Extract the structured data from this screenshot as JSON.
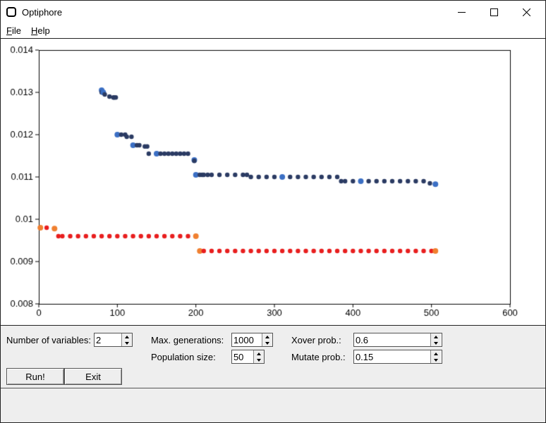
{
  "window": {
    "title": "Optiphore"
  },
  "menu": {
    "file_key": "F",
    "file_rest": "ile",
    "help_key": "H",
    "help_rest": "elp"
  },
  "inputs": {
    "num_vars_label": "Number of variables:",
    "num_vars": "2",
    "max_gen_label": "Max. generations:",
    "max_gen": "1000",
    "pop_size_label": "Population size:",
    "pop_size": "50",
    "xover_label": "Xover prob.:",
    "xover": "0.6",
    "mutate_label": "Mutate prob.:",
    "mutate": "0.15"
  },
  "buttons": {
    "run": "Run!",
    "exit": "Exit"
  },
  "chart_data": {
    "type": "scatter",
    "xlabel": "",
    "ylabel": "",
    "xlim": [
      0,
      600
    ],
    "ylim": [
      0.008,
      0.014
    ],
    "xticks": [
      0,
      100,
      200,
      300,
      400,
      500,
      600
    ],
    "yticks": [
      0.008,
      0.009,
      0.01,
      0.011,
      0.012,
      0.013,
      0.014
    ],
    "color_top": "#2b3b63",
    "color_top_marker": "#3b6fc4",
    "color_bot": "#e81e1e",
    "color_bot_marker": "#f08030",
    "series": [
      {
        "name": "top",
        "x": [
          80,
          80,
          82,
          84,
          90,
          95,
          96,
          98,
          100,
          105,
          110,
          112,
          118,
          120,
          125,
          128,
          135,
          138,
          140,
          150,
          155,
          160,
          165,
          170,
          175,
          180,
          185,
          190,
          198,
          198,
          200,
          205,
          208,
          210,
          215,
          220,
          230,
          240,
          250,
          260,
          265,
          270,
          280,
          290,
          300,
          310,
          320,
          330,
          340,
          350,
          360,
          370,
          380,
          385,
          390,
          400,
          410,
          420,
          430,
          440,
          450,
          460,
          470,
          480,
          490,
          498,
          505
        ],
        "y": [
          0.01305,
          0.013,
          0.013,
          0.01295,
          0.0129,
          0.01288,
          0.01288,
          0.01288,
          0.012,
          0.012,
          0.012,
          0.01195,
          0.01195,
          0.01175,
          0.01175,
          0.01175,
          0.01172,
          0.01172,
          0.01155,
          0.01155,
          0.01155,
          0.01155,
          0.01155,
          0.01155,
          0.01155,
          0.01155,
          0.01155,
          0.01155,
          0.0114,
          0.01138,
          0.01105,
          0.01105,
          0.01105,
          0.01105,
          0.01105,
          0.01105,
          0.01105,
          0.01105,
          0.01105,
          0.01105,
          0.01105,
          0.011,
          0.011,
          0.011,
          0.011,
          0.011,
          0.011,
          0.011,
          0.011,
          0.011,
          0.011,
          0.011,
          0.011,
          0.0109,
          0.0109,
          0.0109,
          0.0109,
          0.0109,
          0.0109,
          0.0109,
          0.0109,
          0.0109,
          0.0109,
          0.0109,
          0.0109,
          0.01085,
          0.01083
        ]
      },
      {
        "name": "bot",
        "x": [
          2,
          10,
          20,
          25,
          30,
          40,
          50,
          60,
          70,
          80,
          90,
          100,
          110,
          120,
          130,
          140,
          150,
          160,
          170,
          180,
          190,
          200,
          205,
          210,
          220,
          230,
          240,
          250,
          260,
          270,
          280,
          290,
          300,
          310,
          320,
          330,
          340,
          350,
          360,
          370,
          380,
          390,
          400,
          410,
          420,
          430,
          440,
          450,
          460,
          470,
          480,
          490,
          500,
          505
        ],
        "y": [
          0.0098,
          0.0098,
          0.00978,
          0.0096,
          0.0096,
          0.0096,
          0.0096,
          0.0096,
          0.0096,
          0.0096,
          0.0096,
          0.0096,
          0.0096,
          0.0096,
          0.0096,
          0.0096,
          0.0096,
          0.0096,
          0.0096,
          0.0096,
          0.0096,
          0.0096,
          0.00925,
          0.00925,
          0.00925,
          0.00925,
          0.00925,
          0.00925,
          0.00925,
          0.00925,
          0.00925,
          0.00925,
          0.00925,
          0.00925,
          0.00925,
          0.00925,
          0.00925,
          0.00925,
          0.00925,
          0.00925,
          0.00925,
          0.00925,
          0.00925,
          0.00925,
          0.00925,
          0.00925,
          0.00925,
          0.00925,
          0.00925,
          0.00925,
          0.00925,
          0.00925,
          0.00925,
          0.00925
        ]
      }
    ],
    "markers": [
      {
        "series": "top",
        "idx": [
          0,
          2,
          8,
          13,
          19,
          28,
          30,
          45,
          56,
          66
        ]
      },
      {
        "series": "bot",
        "idx": [
          0,
          2,
          21,
          22,
          53
        ]
      }
    ]
  }
}
